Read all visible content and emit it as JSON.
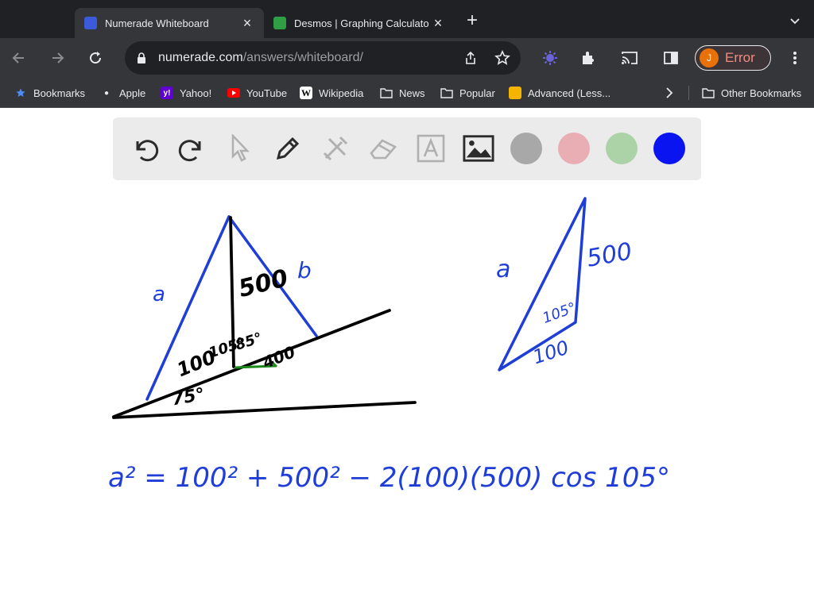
{
  "browser": {
    "tabs": [
      {
        "title": "Numerade Whiteboard",
        "active": true
      },
      {
        "title": "Desmos | Graphing Calculato",
        "active": false
      }
    ],
    "url_host": "numerade.com",
    "url_path": "/answers/whiteboard/",
    "profile": {
      "initial": "J",
      "status": "Error"
    },
    "bookmarks": [
      {
        "label": "Bookmarks",
        "icon": "star-icon"
      },
      {
        "label": "Apple",
        "icon": "apple-icon"
      },
      {
        "label": "Yahoo!",
        "icon": "yahoo-icon"
      },
      {
        "label": "YouTube",
        "icon": "youtube-icon"
      },
      {
        "label": "Wikipedia",
        "icon": "wikipedia-icon"
      },
      {
        "label": "News",
        "icon": "folder-icon"
      },
      {
        "label": "Popular",
        "icon": "folder-icon"
      },
      {
        "label": "Advanced (Less...",
        "icon": "bookmark-icon"
      }
    ],
    "other_bookmarks": "Other Bookmarks"
  },
  "whiteboard": {
    "tools": [
      "undo-icon",
      "redo-icon",
      "pointer-icon",
      "pen-icon",
      "tools-icon",
      "eraser-icon",
      "text-icon",
      "image-icon"
    ],
    "colors": [
      "#a8a8a8",
      "#e8aeb4",
      "#acd2a8",
      "#0a14f0"
    ],
    "ink_colors": {
      "blue": "#1f3ed8",
      "black": "#000000",
      "green": "#1a8a1a"
    },
    "labels": {
      "left_a": "a",
      "left_500": "500",
      "left_b": "b",
      "left_100": "100",
      "left_105": "105°",
      "left_85": "85°",
      "left_75": "75°",
      "left_400": "400",
      "right_a": "a",
      "right_500": "500",
      "right_105": "105°",
      "right_100": "100",
      "equation": "a² = 100² + 500² − 2(100)(500) cos 105°"
    }
  }
}
